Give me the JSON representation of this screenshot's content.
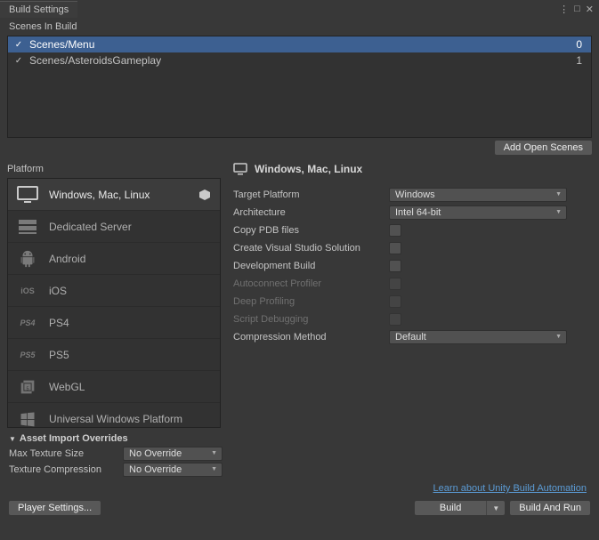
{
  "window": {
    "title": "Build Settings"
  },
  "scenes": {
    "header": "Scenes In Build",
    "items": [
      {
        "name": "Scenes/Menu",
        "index": "0",
        "checked": true,
        "selected": true
      },
      {
        "name": "Scenes/AsteroidsGameplay",
        "index": "1",
        "checked": true,
        "selected": false
      }
    ],
    "add_open_label": "Add Open Scenes"
  },
  "platform": {
    "header": "Platform",
    "items": [
      {
        "label": "Windows, Mac, Linux",
        "icon": "monitor",
        "selected": true,
        "badge": true
      },
      {
        "label": "Dedicated Server",
        "icon": "server",
        "selected": false
      },
      {
        "label": "Android",
        "icon": "android",
        "selected": false
      },
      {
        "label": "iOS",
        "icon": "ios",
        "selected": false
      },
      {
        "label": "PS4",
        "icon": "ps4",
        "selected": false
      },
      {
        "label": "PS5",
        "icon": "ps5",
        "selected": false
      },
      {
        "label": "WebGL",
        "icon": "webgl",
        "selected": false
      },
      {
        "label": "Universal Windows Platform",
        "icon": "uwp",
        "selected": false
      }
    ]
  },
  "details": {
    "header": "Windows, Mac, Linux",
    "rows": [
      {
        "label": "Target Platform",
        "type": "dropdown",
        "value": "Windows",
        "disabled": false
      },
      {
        "label": "Architecture",
        "type": "dropdown",
        "value": "Intel 64-bit",
        "disabled": false
      },
      {
        "label": "Copy PDB files",
        "type": "checkbox",
        "checked": false,
        "disabled": false
      },
      {
        "label": "Create Visual Studio Solution",
        "type": "checkbox",
        "checked": false,
        "disabled": false
      },
      {
        "label": "Development Build",
        "type": "checkbox",
        "checked": false,
        "disabled": false
      },
      {
        "label": "Autoconnect Profiler",
        "type": "checkbox",
        "checked": false,
        "disabled": true
      },
      {
        "label": "Deep Profiling",
        "type": "checkbox",
        "checked": false,
        "disabled": true
      },
      {
        "label": "Script Debugging",
        "type": "checkbox",
        "checked": false,
        "disabled": true
      },
      {
        "label": "Compression Method",
        "type": "dropdown",
        "value": "Default",
        "disabled": false
      }
    ]
  },
  "overrides": {
    "header": "Asset Import Overrides",
    "max_texture_label": "Max Texture Size",
    "max_texture_value": "No Override",
    "texture_comp_label": "Texture Compression",
    "texture_comp_value": "No Override"
  },
  "link": {
    "label": "Learn about Unity Build Automation"
  },
  "footer": {
    "player_settings": "Player Settings...",
    "build": "Build",
    "build_and_run": "Build And Run"
  }
}
